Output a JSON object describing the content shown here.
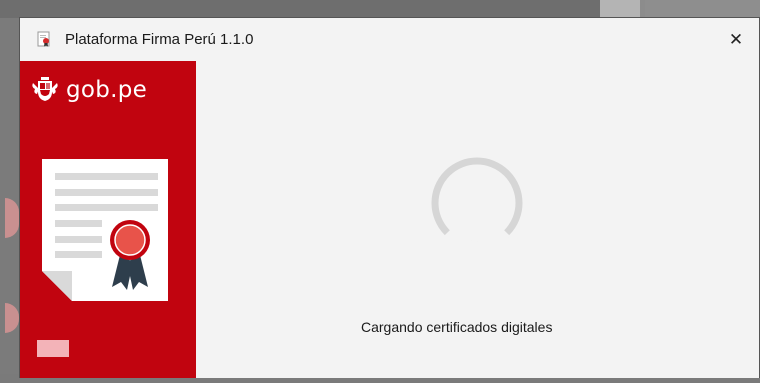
{
  "window": {
    "title": "Plataforma Firma Perú 1.1.0",
    "close_glyph": "✕"
  },
  "sidebar": {
    "logo_text": "gob.pe",
    "brand_color": "#c1040f"
  },
  "main": {
    "status_text": "Cargando certificados digitales",
    "spinner_icon": "loading-spinner-icon"
  }
}
